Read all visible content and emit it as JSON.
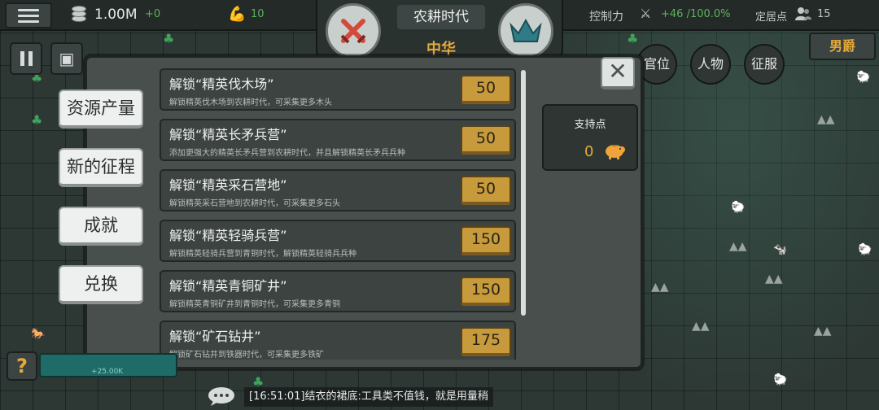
{
  "top": {
    "gold": "1.00M",
    "gold_delta": "+0",
    "strength": "10",
    "era_title": "农耕时代",
    "era_sub": "中华",
    "control_label": "控制力",
    "control_value": "+46 /100.0%",
    "settlement_label": "定居点",
    "settlement_value": "15"
  },
  "right_buttons": {
    "office": "官位",
    "people": "人物",
    "conquest": "征服",
    "rank": "男爵"
  },
  "tabs": [
    "资源产量",
    "新的征程",
    "成就",
    "兑换"
  ],
  "upgrades": [
    {
      "title": "解锁“精英伐木场”",
      "desc": "解锁精英伐木场到农耕时代，可采集更多木头",
      "cost": "50"
    },
    {
      "title": "解锁“精英长矛兵营”",
      "desc": "添加更强大的精英长矛兵营到农耕时代，并且解锁精英长矛兵兵种",
      "cost": "50"
    },
    {
      "title": "解锁“精英采石营地”",
      "desc": "解锁精英采石营地到农耕时代，可采集更多石头",
      "cost": "50"
    },
    {
      "title": "解锁“精英轻骑兵营”",
      "desc": "解锁精英轻骑兵营到青铜时代，解锁精英轻骑兵兵种",
      "cost": "150"
    },
    {
      "title": "解锁“精英青铜矿井”",
      "desc": "解锁精英青铜矿井到青铜时代，可采集更多青铜",
      "cost": "150"
    },
    {
      "title": "解锁“矿石钻井”",
      "desc": "解锁矿石钻井到铁器时代，可采集更多铁矿",
      "cost": "175"
    }
  ],
  "support": {
    "title": "支持点",
    "value": "0"
  },
  "chat": {
    "message": "[16:51:01]结衣的裙底:工具类不值钱，就是用量稍"
  },
  "bottom": {
    "bar_text": "+25.00K"
  },
  "icons": {
    "help": "?",
    "close": "✕"
  }
}
